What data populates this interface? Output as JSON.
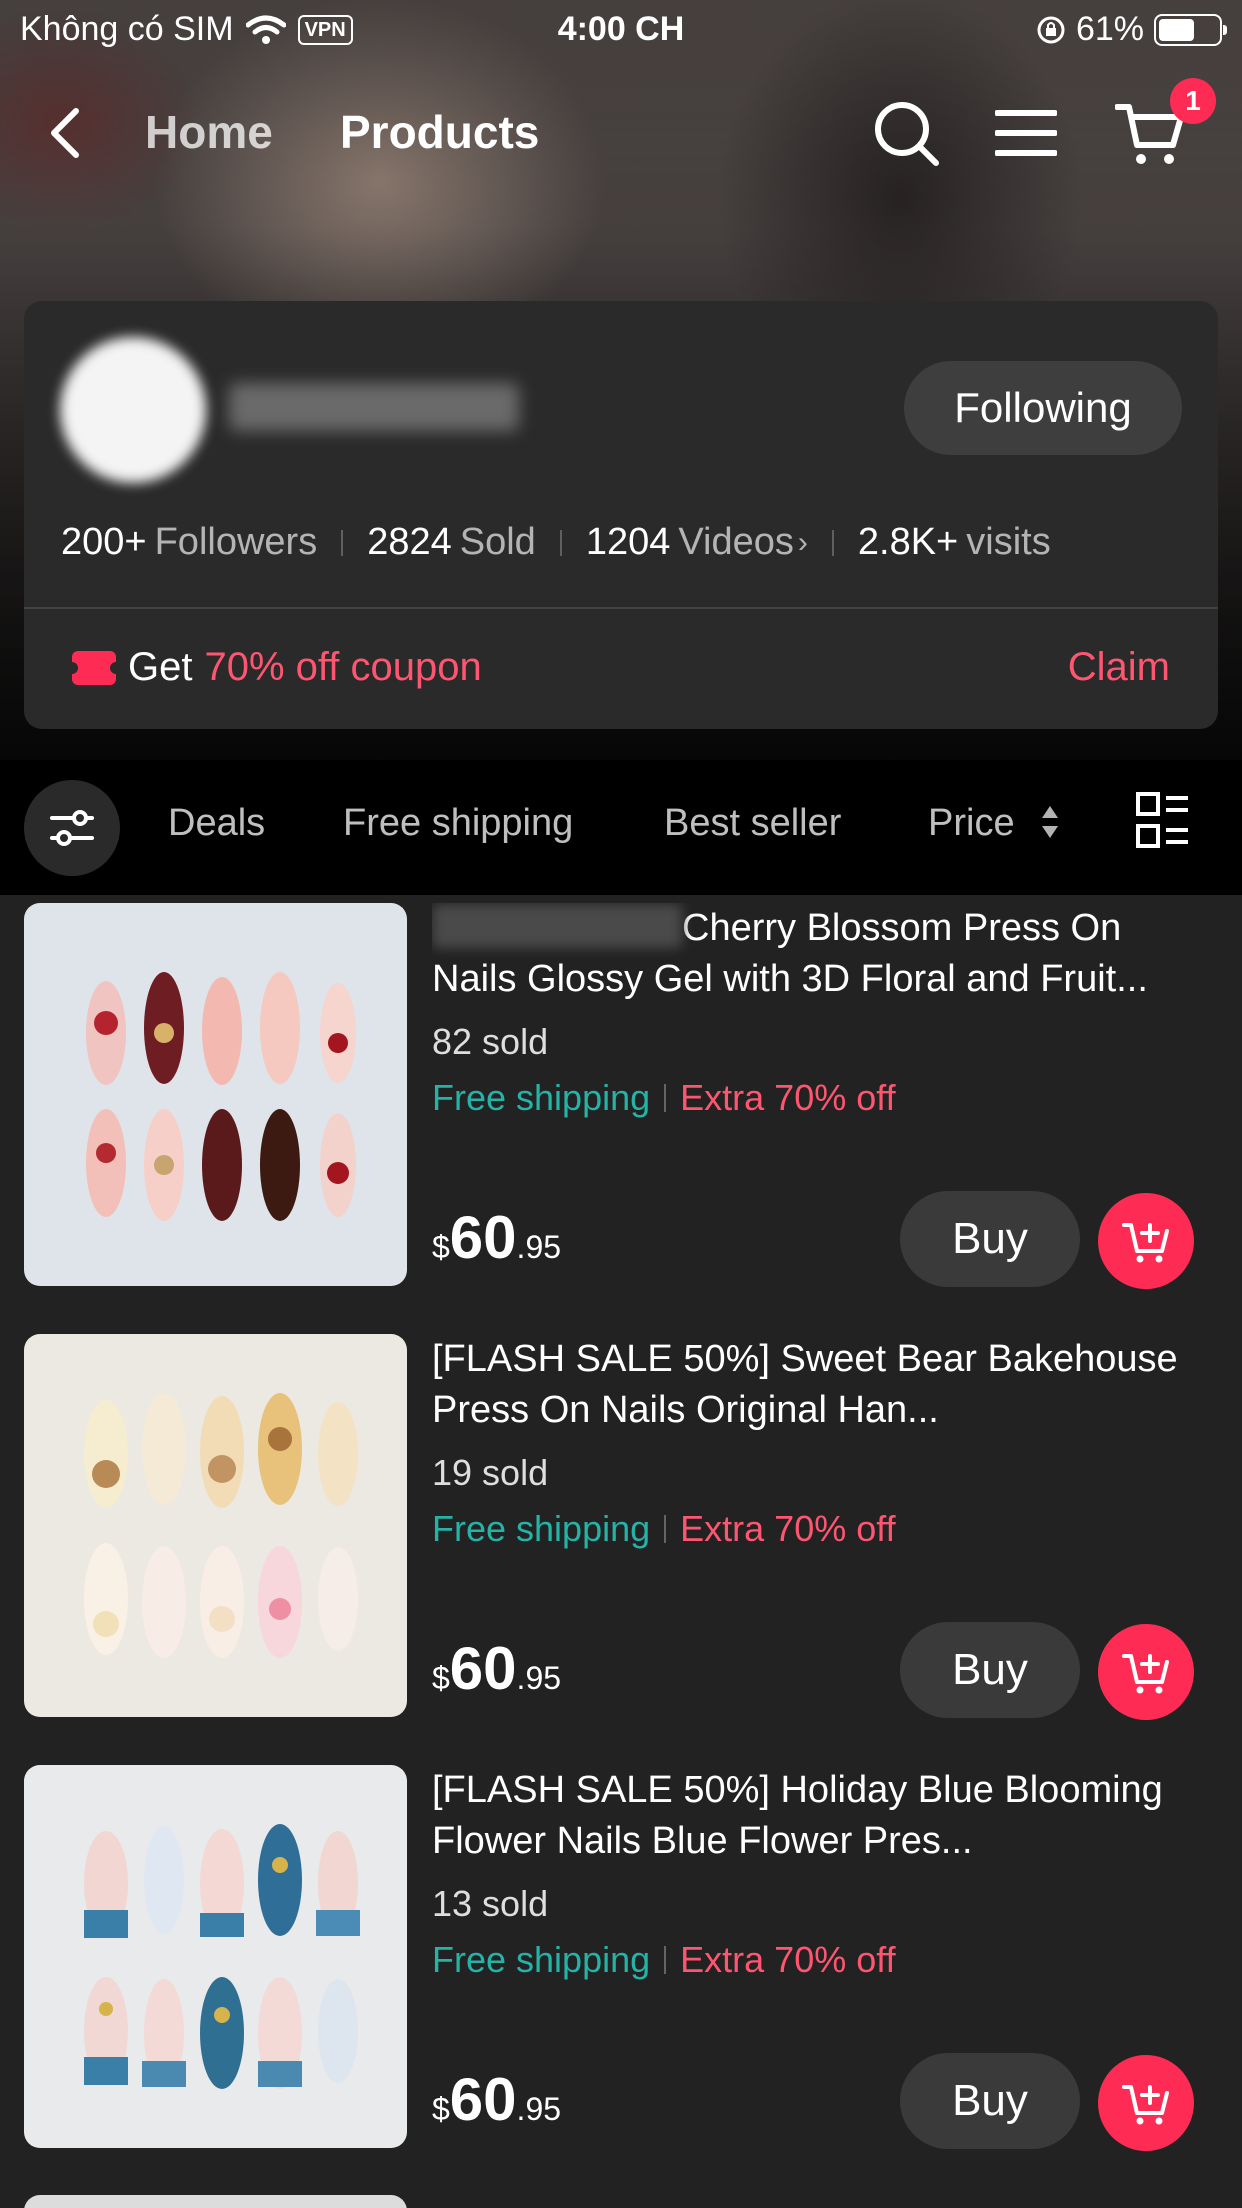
{
  "status_bar": {
    "carrier": "Không có SIM",
    "vpn": "VPN",
    "time": "4:00 CH",
    "battery": "61%",
    "battery_level": 0.61
  },
  "nav": {
    "home": "Home",
    "products": "Products",
    "cart_count": "1"
  },
  "shop": {
    "following_label": "Following",
    "stats": {
      "followers_num": "200+",
      "followers_label": "Followers",
      "sold_num": "2824",
      "sold_label": "Sold",
      "videos_num": "1204",
      "videos_label": "Videos",
      "visits_num": "2.8K+",
      "visits_label": "visits"
    },
    "coupon": {
      "get": "Get",
      "offer": "70% off coupon",
      "claim": "Claim"
    }
  },
  "filters": {
    "deals": "Deals",
    "free_shipping": "Free shipping",
    "best_seller": "Best seller",
    "price": "Price"
  },
  "products": [
    {
      "name": "Cherry Blossom Press On Nails Glossy Gel with 3D Floral and Fruit...",
      "sold": "82 sold",
      "shipping": "Free shipping",
      "discount": "Extra 70% off",
      "currency": "$",
      "price_int": "60",
      "price_dec": ".95",
      "buy": "Buy"
    },
    {
      "name": "[FLASH SALE 50%] Sweet Bear Bakehouse Press On Nails Original Han...",
      "sold": "19 sold",
      "shipping": "Free shipping",
      "discount": "Extra 70% off",
      "currency": "$",
      "price_int": "60",
      "price_dec": ".95",
      "buy": "Buy"
    },
    {
      "name": "[FLASH SALE 50%] Holiday Blue Blooming Flower Nails Blue Flower Pres...",
      "sold": "13 sold",
      "shipping": "Free shipping",
      "discount": "Extra 70% off",
      "currency": "$",
      "price_int": "60",
      "price_dec": ".95",
      "buy": "Buy"
    }
  ],
  "colors": {
    "accent": "#fe2c55",
    "discount_text": "#fe5670",
    "shipping_text": "#24b3a6"
  }
}
